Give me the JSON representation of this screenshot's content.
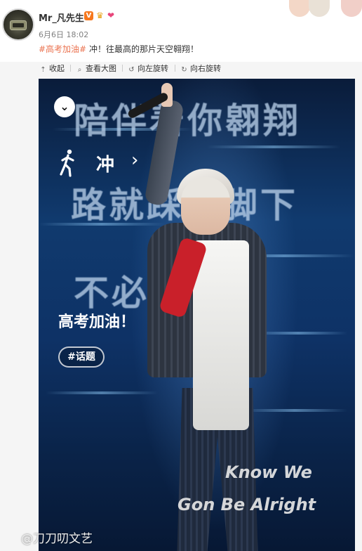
{
  "post": {
    "username": "Mr_凡先生",
    "timestamp": "6月6日 18:02",
    "hashtag": "#高考加油#",
    "text": " 冲！往最高的那片天空翱翔！"
  },
  "badges": {
    "verified": "V",
    "crown": "♛",
    "heart": "❤"
  },
  "toolbar": {
    "collapse_label": "收起",
    "view_large_label": "查看大图",
    "rotate_left_label": "向左旋转",
    "rotate_right_label": "向右旋转"
  },
  "poster": {
    "bg_line_1": "陪伴着你翱翔",
    "bg_line_2": "路就踩在脚下",
    "bg_line_3": "不必        害怕",
    "run_label": "冲",
    "cheer_text": "高考加油！",
    "topic_chip": "#话题",
    "slogan_line_1": "Know We",
    "slogan_line_2": "Gon Be Alright"
  },
  "watermark": "@刀刀叨文艺",
  "colors": {
    "hashtag": "#eb7350",
    "verified_badge": "#f6781e",
    "poster_bg": "#103a6e",
    "jacket_accent": "#c9202a"
  }
}
